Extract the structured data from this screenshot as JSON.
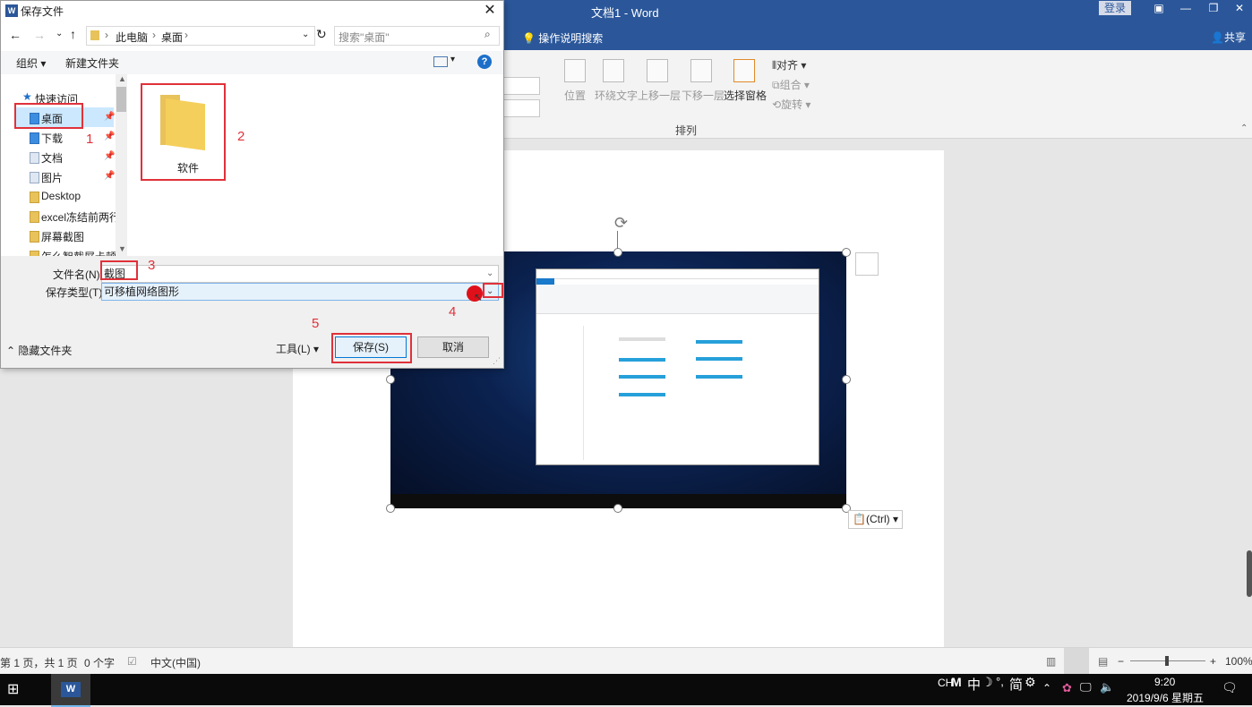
{
  "word": {
    "title": "文档1  -  Word",
    "login": "登录",
    "tell_me": "操作说明搜索",
    "share": "共享",
    "ribbon": {
      "position": "位置",
      "wrap_text": "环绕文字",
      "bring_forward": "上移一层",
      "send_backward": "下移一层",
      "selection_pane": "选择窗格",
      "align": "对齐",
      "group": "组合",
      "rotate": "旋转",
      "group_label": "排列"
    },
    "paste_options": "(Ctrl)",
    "status": {
      "page": "第 1 页，共 1 页",
      "words": "0 个字",
      "lang": "中文(中国)",
      "zoom": "100%"
    }
  },
  "dialog": {
    "title": "保存文件",
    "breadcrumb": [
      "此电脑",
      "桌面"
    ],
    "search_placeholder": "搜索\"桌面\"",
    "toolbar": {
      "organize": "组织",
      "new_folder": "新建文件夹"
    },
    "nav": {
      "quick_access": "快速访问",
      "items": [
        "桌面",
        "下载",
        "文档",
        "图片",
        "Desktop",
        "excel冻结前两行",
        "屏幕截图",
        "怎么智截屏卡顿"
      ]
    },
    "file_item": "软件",
    "filename_label": "文件名(N):",
    "filename_value": "截图",
    "filetype_label": "保存类型(T):",
    "filetype_value": "可移植网络图形",
    "hide_folders": "隐藏文件夹",
    "tools": "工具(L)",
    "save": "保存(S)",
    "cancel": "取消"
  },
  "annotations": [
    "1",
    "2",
    "3",
    "4",
    "5"
  ],
  "taskbar": {
    "ime": "CH",
    "ime_mode": "中",
    "ime_simplified": "简",
    "time": "9:20",
    "date": "2019/9/6 星期五"
  },
  "colors": {
    "word_blue": "#2b579a",
    "annotation_red": "#e0313a",
    "folder_yellow": "#f5cf5b"
  }
}
